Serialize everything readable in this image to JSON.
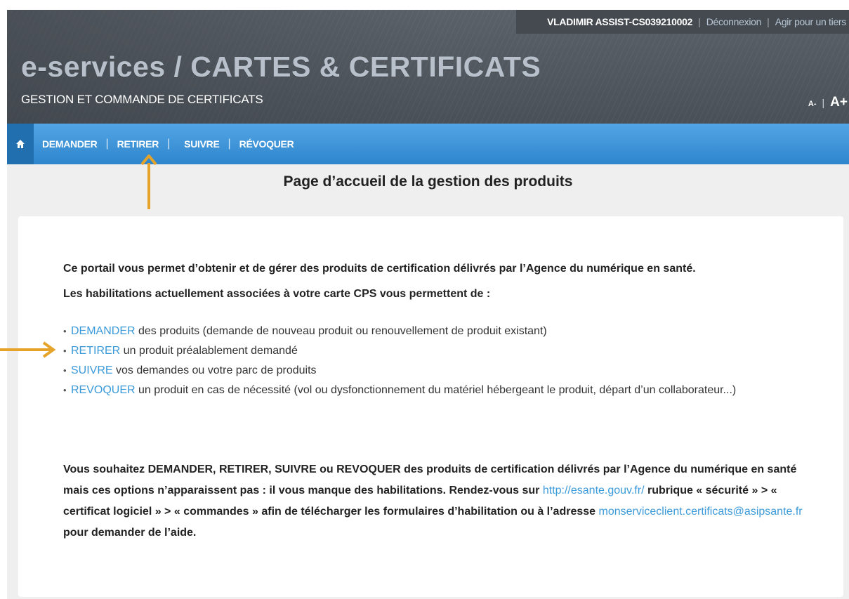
{
  "header": {
    "user_name": "VLADIMIR ASSIST-CS039210002",
    "logout_label": "Déconnexion",
    "act_for_third_party_label": "Agir pour un tiers",
    "title": "e-services / CARTES & CERTIFICATS",
    "subtitle": "GESTION ET COMMANDE DE CERTIFICATS",
    "font_decrease_label": "A-",
    "font_increase_label": "A+"
  },
  "nav": {
    "items": [
      {
        "label": "DEMANDER"
      },
      {
        "label": "RETIRER"
      },
      {
        "label": "SUIVRE"
      },
      {
        "label": "RÉVOQUER"
      }
    ]
  },
  "page": {
    "title": "Page d’accueil de la gestion des produits",
    "intro_1": "Ce portail vous permet d’obtenir et de gérer des produits de certification délivrés par l’Agence du numérique en santé.",
    "intro_2": "Les habilitations actuellement associées à votre carte CPS vous permettent de :",
    "list": [
      {
        "keyword": "DEMANDER",
        "text": " des produits (demande de nouveau produit ou renouvellement de produit existant)"
      },
      {
        "keyword": "RETIRER",
        "text": " un produit préalablement demandé"
      },
      {
        "keyword": "SUIVRE",
        "text": " vos demandes ou votre parc de produits"
      },
      {
        "keyword": "REVOQUER",
        "text": " un produit en cas de nécessité (vol ou dysfonctionnement du matériel hébergeant le produit, départ d’un collaborateur...)"
      }
    ],
    "outro": {
      "p1": "Vous souhaitez ",
      "p2": "DEMANDER, RETIRER, SUIVRE",
      "p3": " ou ",
      "p4": "REVOQUER",
      "p5": " des produits de certification délivrés par l’Agence du numérique en santé mais ces options n’apparaissent pas : il vous manque des habilitations. Rendez-vous sur ",
      "link_url": "http://esante.gouv.fr/",
      "p6": " rubrique « sécurité » > « certificat logiciel » > « commandes » afin de télécharger les formulaires d’habilitation ou à l’adresse ",
      "email": "monserviceclient.certificats@asipsante.fr",
      "p7": " pour demander de l’aide."
    }
  },
  "annotations": {
    "arrow_color": "#e5a32a"
  },
  "icons": {
    "home": "home-icon",
    "arrows": "arrow-up-icon, arrow-right-icon"
  }
}
